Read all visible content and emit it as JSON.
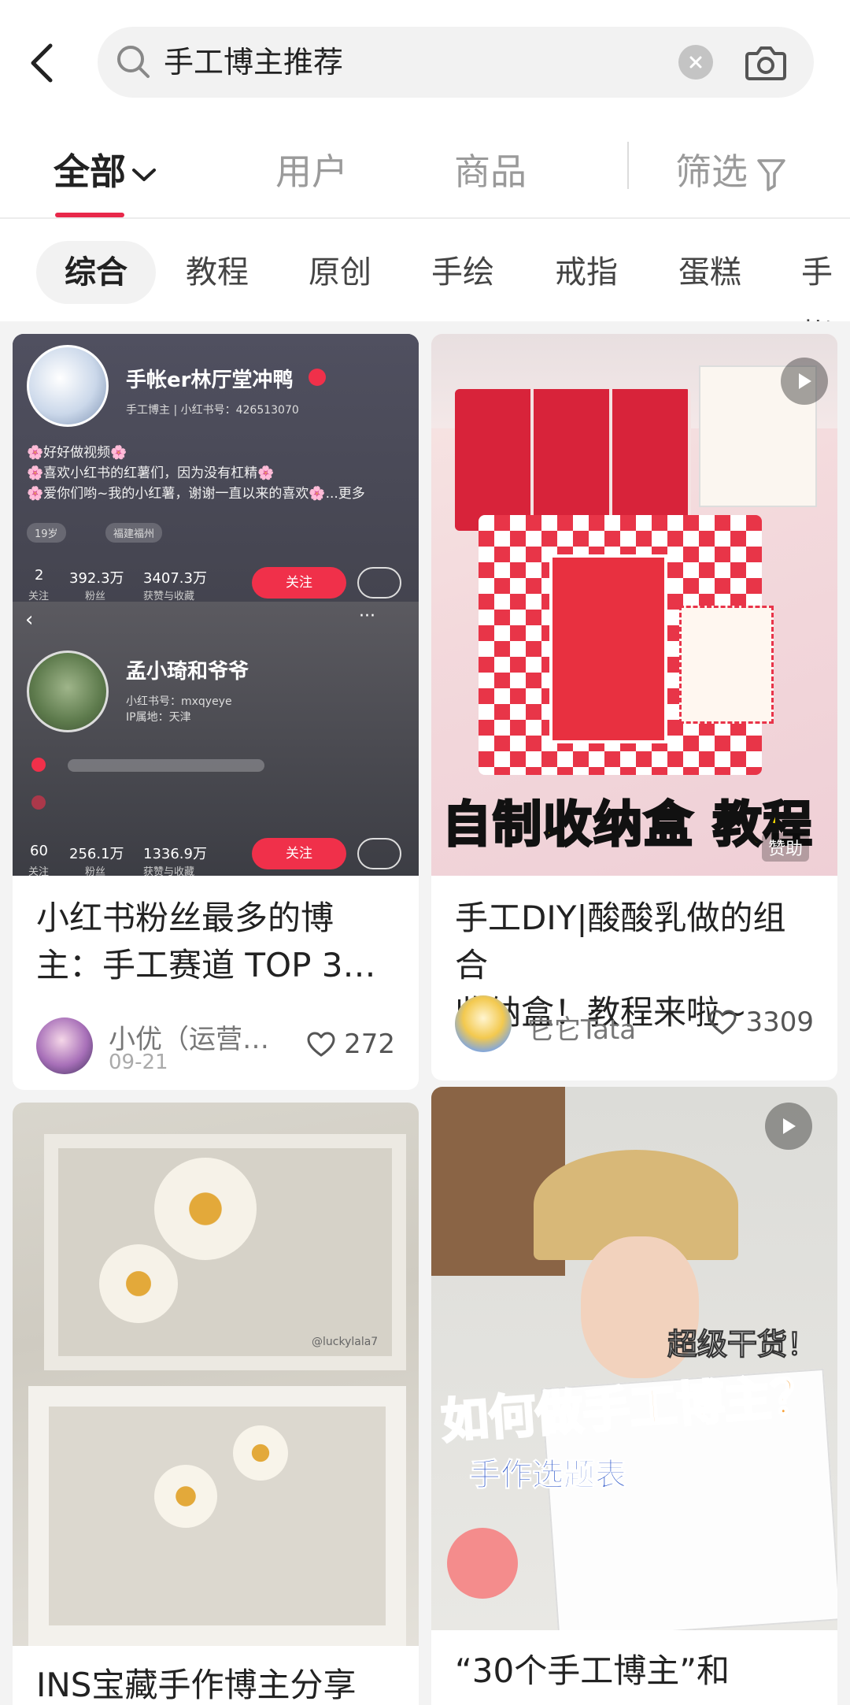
{
  "search": {
    "query": "手工博主推荐"
  },
  "tabs": [
    {
      "label": "全部"
    },
    {
      "label": "用户"
    },
    {
      "label": "商品"
    },
    {
      "label": "筛选"
    }
  ],
  "chips": [
    "综合",
    "教程",
    "原创",
    "手绘",
    "戒指",
    "蛋糕",
    "手帐"
  ],
  "cards": [
    {
      "title_line1": "小红书粉丝最多的博",
      "title_line2": "主：手工赛道 TOP 3…",
      "author": "小优（运营…",
      "date": "09-21",
      "likes": "272",
      "profile1": {
        "name": "手帐er林厅堂冲鸭",
        "sub": "手工博主 | 小红书号：426513070",
        "bio1": "🌸好好做视频🌸",
        "bio2": "🌸喜欢小红书的红薯们，因为没有杠精🌸",
        "bio3": "🌸爱你们哟~我的小红薯，谢谢一直以来的喜欢🌸...更多",
        "tag1": "19岁",
        "tag2": "福建福州",
        "stat1_num": "2",
        "stat1_lbl": "关注",
        "stat2_num": "392.3万",
        "stat2_lbl": "粉丝",
        "stat3_num": "3407.3万",
        "stat3_lbl": "获赞与收藏",
        "follow": "关注"
      },
      "profile2": {
        "name": "孟小琦和爷爷",
        "sub1": "小红书号：mxqyeye",
        "sub2": "IP属地：天津",
        "stat1_num": "60",
        "stat1_lbl": "关注",
        "stat2_num": "256.1万",
        "stat2_lbl": "粉丝",
        "stat3_num": "1336.9万",
        "stat3_lbl": "获赞与收藏",
        "follow": "关注"
      }
    },
    {
      "title_line1": "手工DIY|酸酸乳做的组合",
      "title_line2": "收纳盒！教程来啦~",
      "author": "它它Tata",
      "likes": "3309",
      "overlay": "自制收纳盒 教程",
      "sponsor": "赞助"
    },
    {
      "title_line1": "INS宝藏手作博主分享",
      "watermark": "@luckylala7"
    },
    {
      "title_line1": "“30个手工博主”和",
      "overlay1": "超级干货！",
      "overlay2": "如何做手工博主？",
      "overlay3": "手作选题表"
    }
  ],
  "colors": {
    "accent": "#e8284a",
    "follow": "#f0304a"
  }
}
